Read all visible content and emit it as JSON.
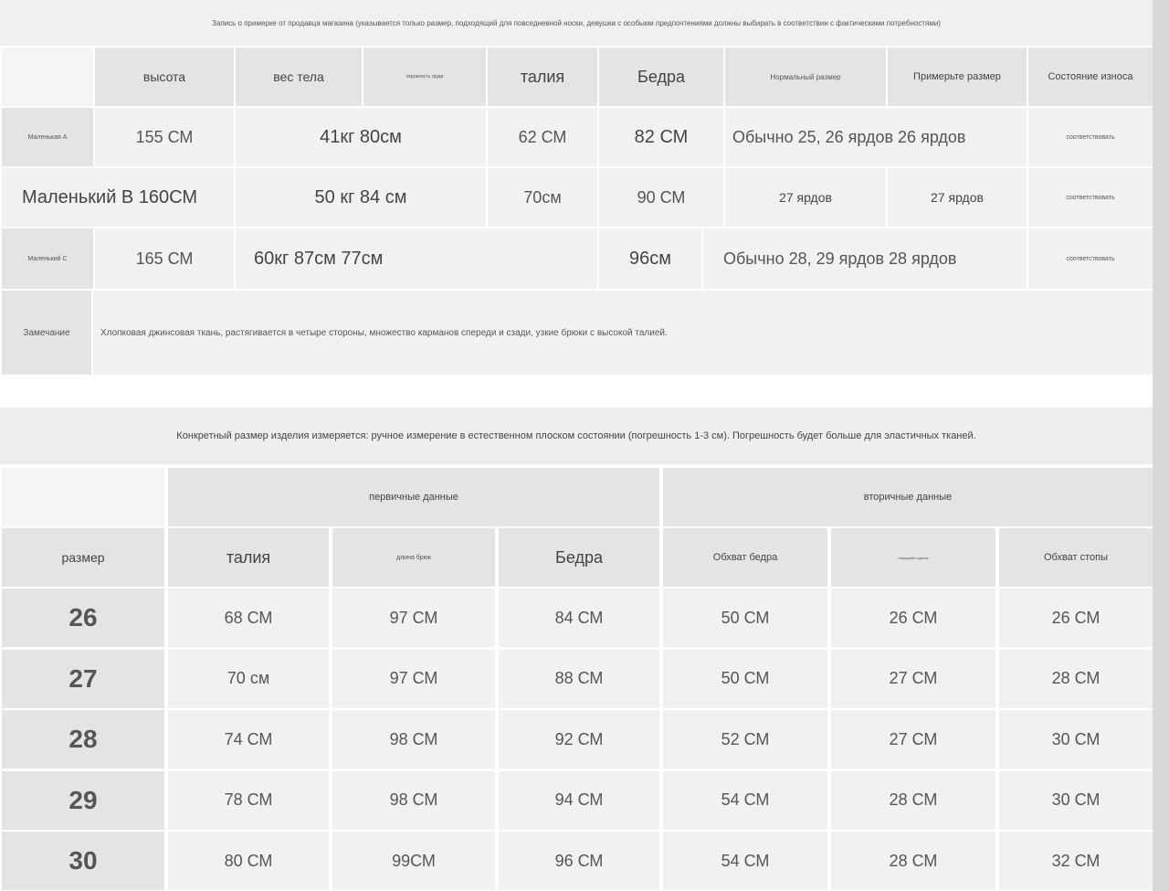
{
  "fitting": {
    "title": "Запись о примерке от продавца магазина (указывается только размер, подходящий для повседневной носки, девушки с особыми предпочтениями должны выбирать в соответствии с фактическими потребностями)",
    "headers": [
      "высота",
      "вес тела",
      "окружность груди",
      "талия",
      "Бедра",
      "Нормальный размер",
      "Примерьте размер",
      "Состояние износа"
    ],
    "rows": [
      {
        "label": "Маленькая А",
        "height": "155 СМ",
        "weight_chest": "41кг 80см",
        "waist": "62 СМ",
        "hips": "82 СМ",
        "normal_try": "Обычно 25, 26 ярдов 26 ярдов",
        "status": "соответствовать"
      },
      {
        "label_height": "Маленький В 160СМ",
        "weight_chest": "50 кг 84 см",
        "waist": "70см",
        "hips": "90 СМ",
        "normal": "27 ярдов",
        "try": "27 ярдов",
        "status": "соответствовать"
      },
      {
        "label": "Маленький С",
        "height": "165 СМ",
        "weight_chest_waist": "60кг 87см 77см",
        "hips": "96см",
        "normal_try": "Обычно 28, 29 ярдов 28 ярдов",
        "status": "соответствовать"
      }
    ],
    "remark_label": "Замечание",
    "remark_text": "Хлопковая джинсовая ткань, растягивается в четыре стороны, множество карманов спереди и сзади, узкие брюки с высокой талией."
  },
  "measure": {
    "title": "Конкретный размер изделия измеряется: ручное измерение в естественном плоском состоянии (погрешность 1-3 см). Погрешность будет больше для эластичных тканей.",
    "group_primary": "первичные данные",
    "group_secondary": "вторичные данные",
    "headers": [
      "размер",
      "талия",
      "длина брюк",
      "Бедра",
      "Обхват бедра",
      "передний подъем",
      "Обхват стопы"
    ],
    "rows": [
      {
        "size": "26",
        "cells": [
          "68 СМ",
          "97 СМ",
          "84 СМ",
          "50 СМ",
          "26 СМ",
          "26 СМ"
        ]
      },
      {
        "size": "27",
        "cells": [
          "70 см",
          "97 СМ",
          "88 СМ",
          "50 СМ",
          "27 СМ",
          "28 СМ"
        ]
      },
      {
        "size": "28",
        "cells": [
          "74 СМ",
          "98 СМ",
          "92 СМ",
          "52 СМ",
          "27 СМ",
          "30 СМ"
        ]
      },
      {
        "size": "29",
        "cells": [
          "78 СМ",
          "98 СМ",
          "94 СМ",
          "54 СМ",
          "28 СМ",
          "30 СМ"
        ]
      },
      {
        "size": "30",
        "cells": [
          "80 СМ",
          "99СМ",
          "96 СМ",
          "54 СМ",
          "28 СМ",
          "32 СМ"
        ]
      }
    ]
  }
}
